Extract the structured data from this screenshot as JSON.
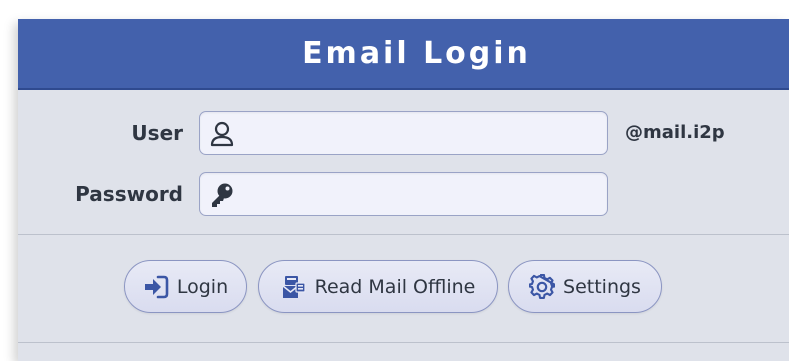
{
  "header": {
    "title": "Email Login"
  },
  "form": {
    "user_label": "User",
    "user_value": "",
    "user_placeholder": "",
    "password_label": "Password",
    "password_value": "",
    "password_placeholder": "",
    "domain_suffix": "@mail.i2p"
  },
  "buttons": {
    "login": "Login",
    "read_offline": "Read Mail Offline",
    "settings": "Settings"
  },
  "icons": {
    "user": "user-icon",
    "password": "key-icon",
    "login": "sign-in-icon",
    "read_offline": "mail-offline-icon",
    "settings": "gear-icon"
  },
  "colors": {
    "header_bg": "#4361ac",
    "panel_bg": "#dfe2ea",
    "icon_blue": "#3b56a5",
    "text": "#2f3642"
  }
}
